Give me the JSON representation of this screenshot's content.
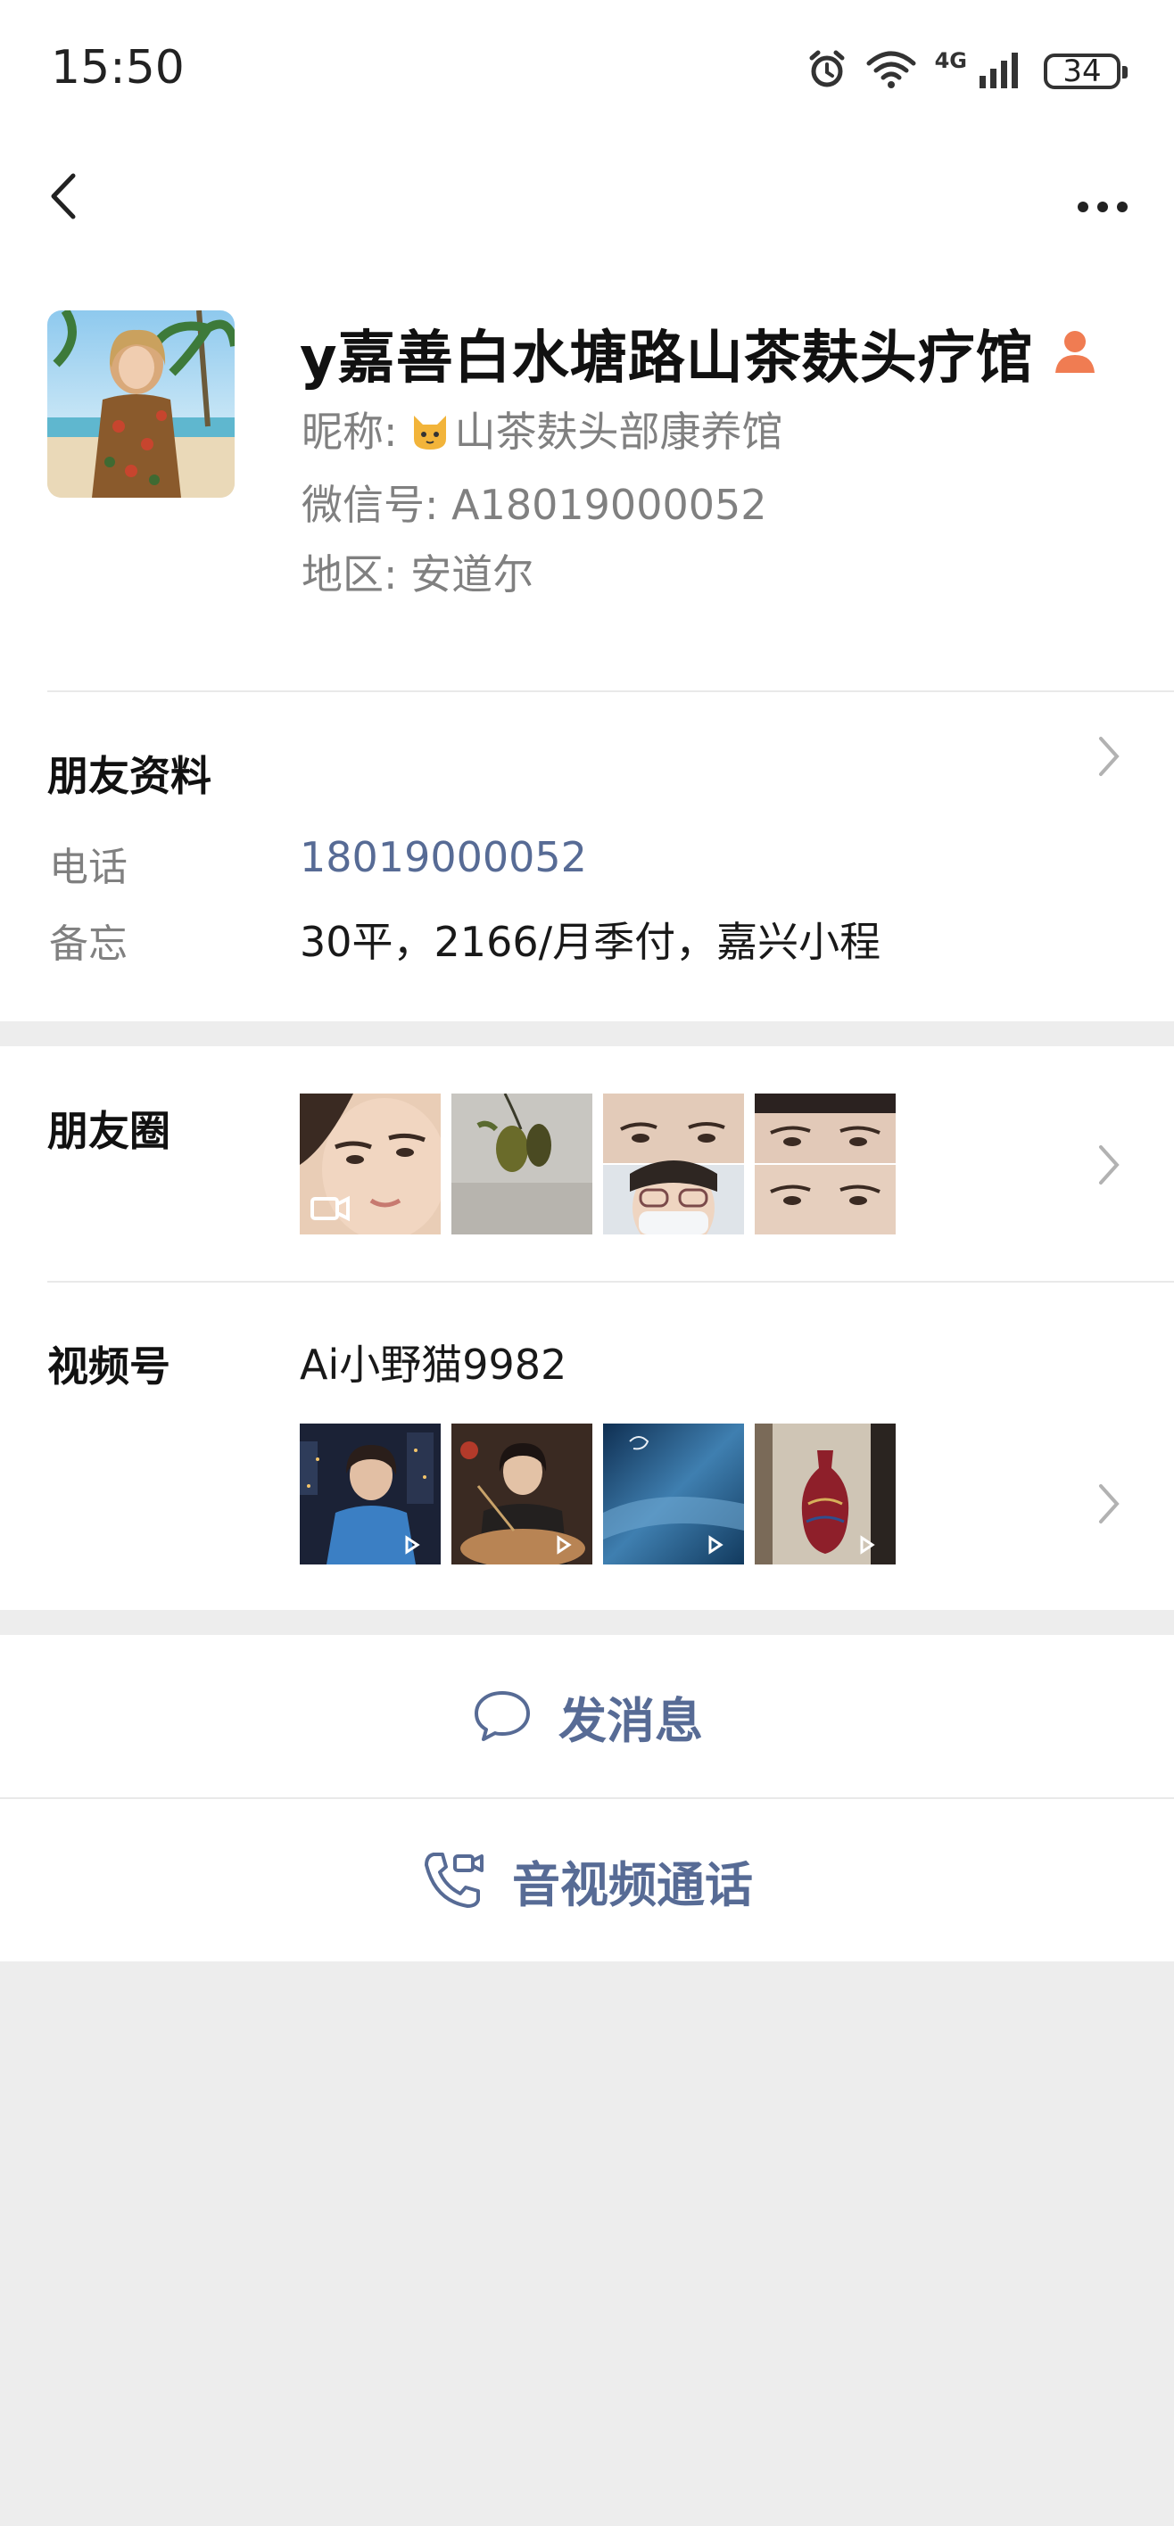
{
  "status_bar": {
    "time": "15:50",
    "net_label": "4G",
    "battery": "34"
  },
  "profile": {
    "display_name": "y嘉善白水塘路山茶麸头疗馆",
    "nickname_label": "昵称:",
    "nickname": "山茶麸头部康养馆",
    "wechat_id_label": "微信号:",
    "wechat_id": "A18019000052",
    "region_label": "地区:",
    "region": "安道尔"
  },
  "friend_info": {
    "title": "朋友资料",
    "phone_label": "电话",
    "phone": "18019000052",
    "note_label": "备忘",
    "note": "30平，2166/月季付，嘉兴小程"
  },
  "moments": {
    "title": "朋友圈",
    "thumbnails": [
      "video-face",
      "fruit-branch",
      "face-collage",
      "eyes-collage"
    ]
  },
  "channels": {
    "title": "视频号",
    "account": "Ai小野猫9982",
    "thumbnails": [
      "woman-blue-suit",
      "woman-dining",
      "blue-blur",
      "red-vase"
    ]
  },
  "actions": {
    "message": "发消息",
    "call": "音视频通话"
  },
  "colors": {
    "link": "#576b95",
    "background": "#ededed",
    "badge": "#f07c52"
  }
}
